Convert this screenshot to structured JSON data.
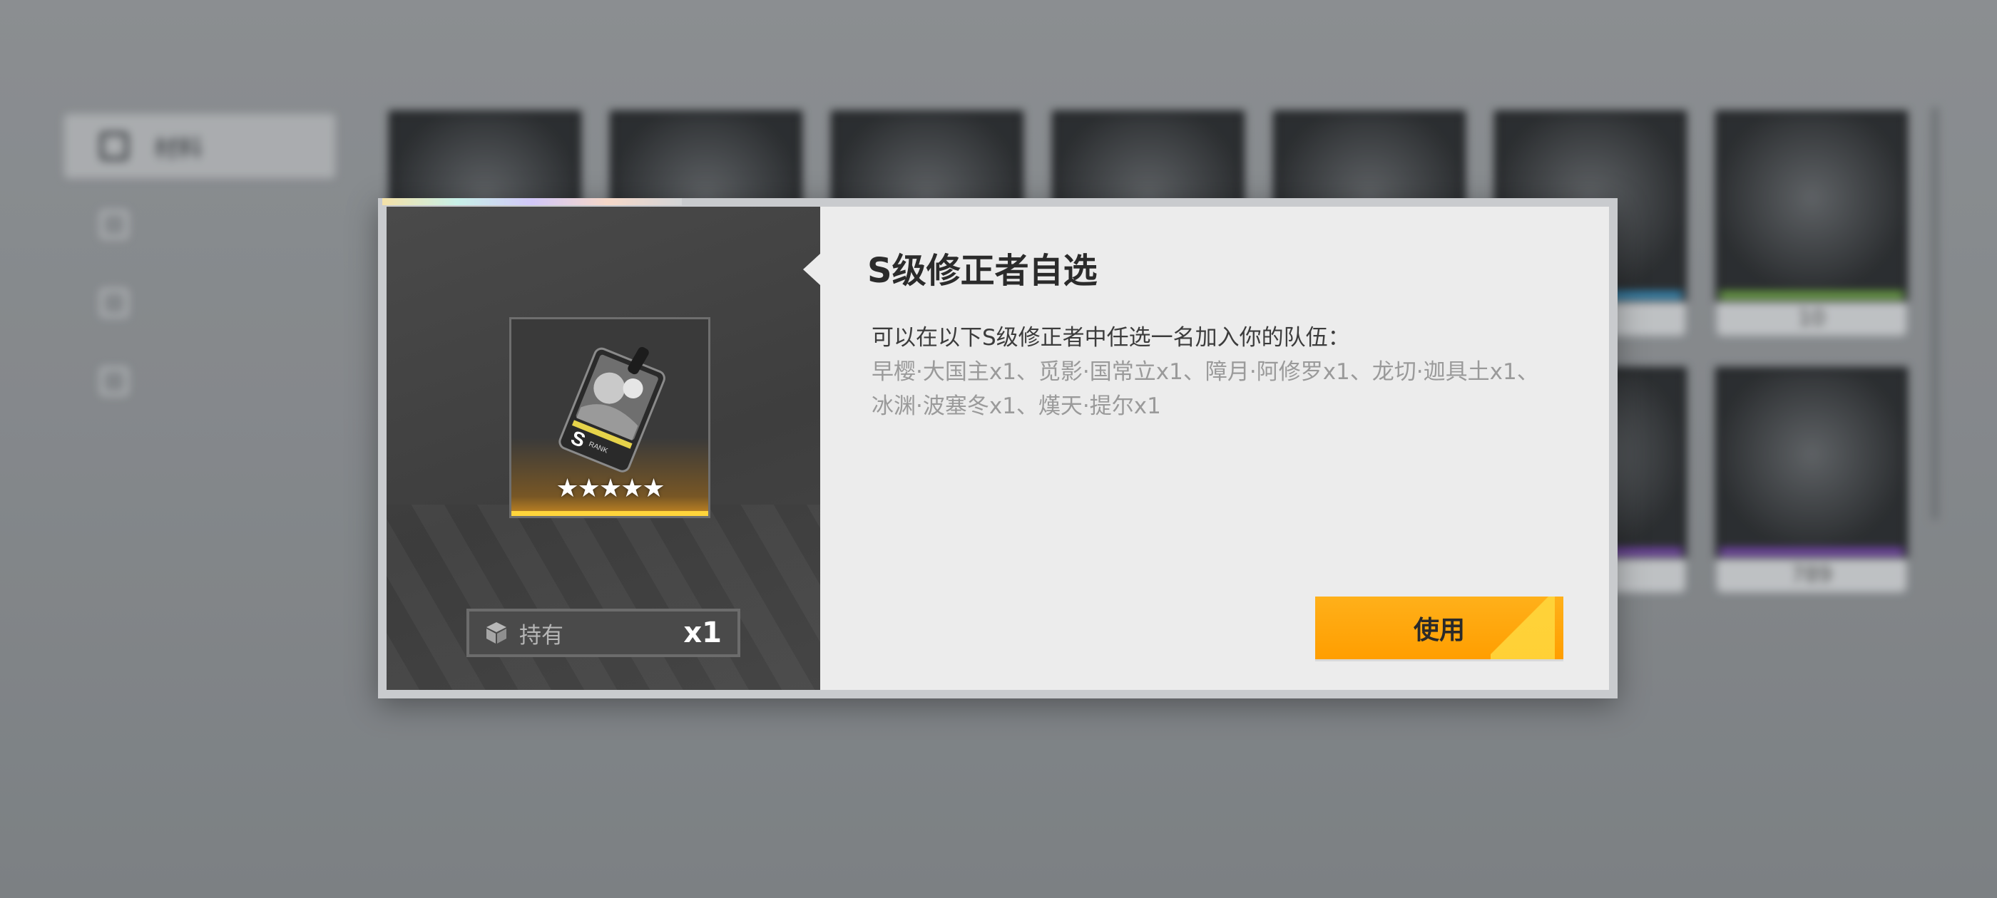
{
  "background": {
    "sidebar": {
      "items": [
        {
          "label": "材料",
          "icon": "materials-icon",
          "active": true
        },
        {
          "label": "",
          "icon": "equipment-icon",
          "active": false
        },
        {
          "label": "",
          "icon": "character-icon",
          "active": false
        },
        {
          "label": "",
          "icon": "gift-icon",
          "active": false
        }
      ]
    },
    "grid_counts": [
      "",
      "",
      "",
      "",
      "",
      "",
      "10",
      "",
      "",
      "",
      "",
      "",
      "",
      "789"
    ]
  },
  "dialog": {
    "title": "S级修正者自选",
    "description_intro": "可以在以下S级修正者中任选一名加入你的队伍：",
    "description_list_line1": "早樱·大国主x1、觅影·国常立x1、障月·阿修罗x1、龙切·迦具土x1、",
    "description_list_line2": "冰渊·波塞冬x1、熯天·提尔x1",
    "item": {
      "icon": "s-rank-card-icon",
      "rank_letter": "S",
      "rank_text": "RANK",
      "stars": "★★★★★",
      "rarity": 5
    },
    "holding": {
      "icon": "box-icon",
      "label": "持有",
      "count": "x1"
    },
    "use_button_label": "使用",
    "colors": {
      "accent": "#ffa200",
      "panel_dark": "#424242",
      "panel_light": "#ececec",
      "rarity_gold": "#ffd43b"
    }
  }
}
